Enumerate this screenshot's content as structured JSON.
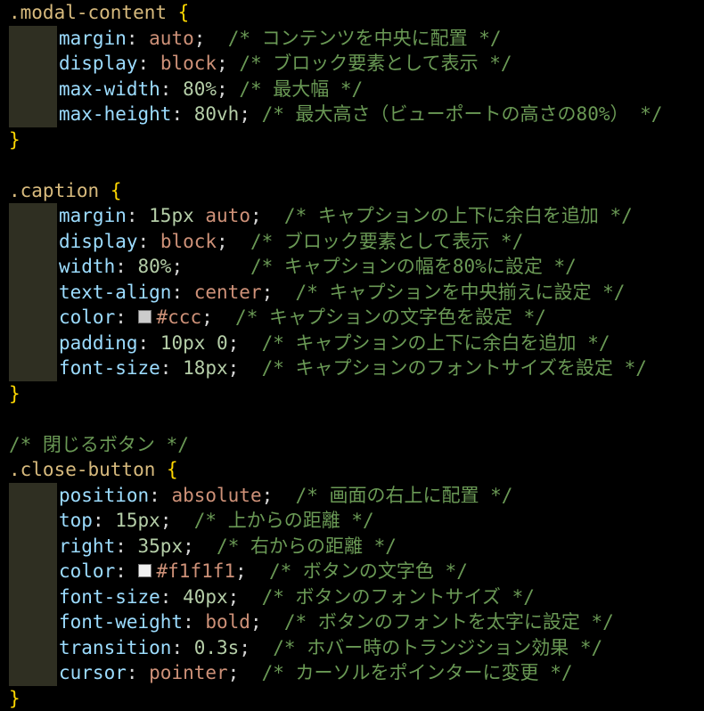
{
  "colors": {
    "background": "#000000",
    "selector": "#d7ba7d",
    "brace": "#ffd700",
    "property": "#9cdcfe",
    "number": "#b5cea8",
    "keyword": "#ce9178",
    "comment": "#6a9955",
    "swatch_ccc": "#cccccc",
    "swatch_f1f1f1": "#f1f1f1"
  },
  "lines": [
    {
      "type": "open",
      "selector": ".modal-content",
      "brace": "{"
    },
    {
      "type": "decl",
      "prop": "margin",
      "value": "auto",
      "vclass": "kw",
      "comment": "/* コンテンツを中央に配置 */",
      "pad": "  "
    },
    {
      "type": "decl",
      "prop": "display",
      "value": "block",
      "vclass": "kw",
      "comment": "/* ブロック要素として表示 */",
      "pad": " "
    },
    {
      "type": "decl",
      "prop": "max-width",
      "value": "80%",
      "vclass": "num",
      "comment": "/* 最大幅 */",
      "pad": " "
    },
    {
      "type": "decl",
      "prop": "max-height",
      "value": "80vh",
      "vclass": "num",
      "comment": "/* 最大高さ（ビューポートの高さの80%） */",
      "pad": " "
    },
    {
      "type": "close",
      "brace": "}"
    },
    {
      "type": "blank"
    },
    {
      "type": "open",
      "selector": ".caption",
      "brace": "{"
    },
    {
      "type": "decl",
      "prop": "margin",
      "value": "15px auto",
      "vclass": "mixed",
      "num": "15px",
      "kw": "auto",
      "comment": "/* キャプションの上下に余白を追加 */",
      "pad": "  "
    },
    {
      "type": "decl",
      "prop": "display",
      "value": "block",
      "vclass": "kw",
      "comment": "/* ブロック要素として表示 */",
      "pad": "  "
    },
    {
      "type": "decl",
      "prop": "width",
      "value": "80%",
      "vclass": "num",
      "comment": "/* キャプションの幅を80%に設定 */",
      "pad": "      "
    },
    {
      "type": "decl",
      "prop": "text-align",
      "value": "center",
      "vclass": "kw",
      "comment": "/* キャプションを中央揃えに設定 */",
      "pad": "  "
    },
    {
      "type": "decl",
      "prop": "color",
      "value": "#ccc",
      "vclass": "kw",
      "swatch": "#cccccc",
      "comment": "/* キャプションの文字色を設定 */",
      "pad": "  "
    },
    {
      "type": "decl",
      "prop": "padding",
      "value": "10px 0",
      "vclass": "num",
      "comment": "/* キャプションの上下に余白を追加 */",
      "pad": "  "
    },
    {
      "type": "decl",
      "prop": "font-size",
      "value": "18px",
      "vclass": "num",
      "comment": "/* キャプションのフォントサイズを設定 */",
      "pad": "  "
    },
    {
      "type": "close",
      "brace": "}"
    },
    {
      "type": "blank"
    },
    {
      "type": "comment",
      "text": "/* 閉じるボタン */"
    },
    {
      "type": "open",
      "selector": ".close-button",
      "brace": "{"
    },
    {
      "type": "decl",
      "prop": "position",
      "value": "absolute",
      "vclass": "kw",
      "comment": "/* 画面の右上に配置 */",
      "pad": "  "
    },
    {
      "type": "decl",
      "prop": "top",
      "value": "15px",
      "vclass": "num",
      "comment": "/* 上からの距離 */",
      "pad": "  "
    },
    {
      "type": "decl",
      "prop": "right",
      "value": "35px",
      "vclass": "num",
      "comment": "/* 右からの距離 */",
      "pad": "  "
    },
    {
      "type": "decl",
      "prop": "color",
      "value": "#f1f1f1",
      "vclass": "kw",
      "swatch": "#f1f1f1",
      "comment": "/* ボタンの文字色 */",
      "pad": "  "
    },
    {
      "type": "decl",
      "prop": "font-size",
      "value": "40px",
      "vclass": "num",
      "comment": "/* ボタンのフォントサイズ */",
      "pad": "  "
    },
    {
      "type": "decl",
      "prop": "font-weight",
      "value": "bold",
      "vclass": "kw",
      "comment": "/* ボタンのフォントを太字に設定 */",
      "pad": "  "
    },
    {
      "type": "decl",
      "prop": "transition",
      "value": "0.3s",
      "vclass": "num",
      "comment": "/* ホバー時のトランジション効果 */",
      "pad": "  "
    },
    {
      "type": "decl",
      "prop": "cursor",
      "value": "pointer",
      "vclass": "kw",
      "comment": "/* カーソルをポインターに変更 */",
      "pad": "  "
    },
    {
      "type": "close",
      "brace": "}"
    }
  ]
}
